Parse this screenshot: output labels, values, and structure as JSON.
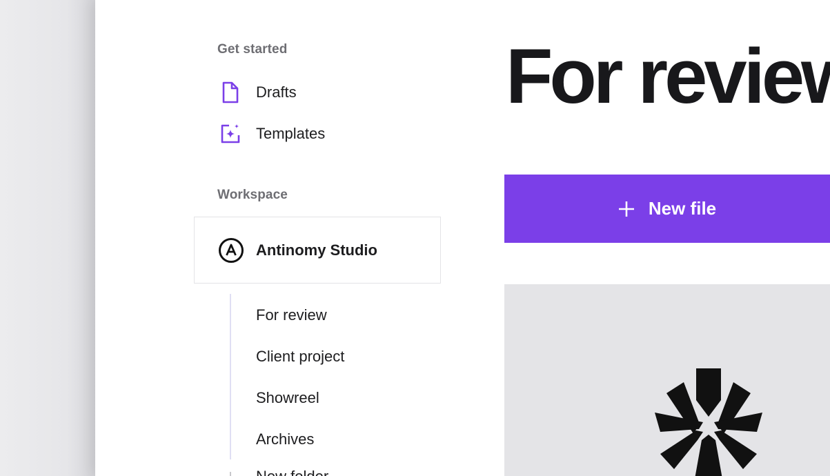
{
  "sidebar": {
    "get_started_label": "Get started",
    "get_started_items": [
      {
        "label": "Drafts",
        "icon": "document-icon"
      },
      {
        "label": "Templates",
        "icon": "sparkle-template-icon"
      }
    ],
    "workspace_label": "Workspace",
    "workspace": {
      "name": "Antinomy Studio",
      "icon_letter": "A"
    },
    "folders": [
      "For review",
      "Client project",
      "Showreel",
      "Archives"
    ],
    "cut_off_item": "New folder"
  },
  "main": {
    "title": "For review",
    "new_file_label": "New file"
  },
  "colors": {
    "accent": "#7b3fe8",
    "icon_purple": "#7b3fe8",
    "title_text": "#18181b",
    "preview_bg": "#e4e4e7"
  }
}
